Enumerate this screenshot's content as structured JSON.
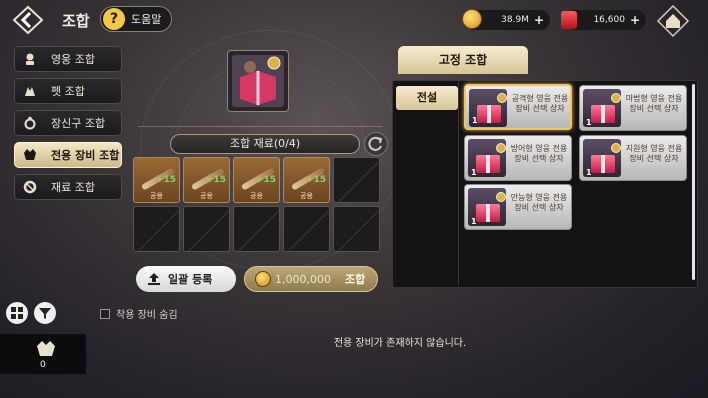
{
  "header": {
    "title": "조합",
    "help_label": "도움말",
    "help_glyph": "?"
  },
  "currency": {
    "gold": "38.9M",
    "gem": "16,600"
  },
  "menu": {
    "items": [
      {
        "label": "영웅 조합"
      },
      {
        "label": "펫 조합"
      },
      {
        "label": "장신구 조합"
      },
      {
        "label": "전용 장비 조합"
      },
      {
        "label": "재료 조합"
      }
    ],
    "active_index": 3
  },
  "materials": {
    "header": "조합 재료(0/4)",
    "cells": [
      {
        "plus": "+15",
        "tag": "공용"
      },
      {
        "plus": "+15",
        "tag": "공용"
      },
      {
        "plus": "+15",
        "tag": "공용"
      },
      {
        "plus": "+15",
        "tag": "공용"
      }
    ]
  },
  "actions": {
    "bulk_register": "일괄 등록",
    "cost": "1,000,000",
    "combine": "조합"
  },
  "fixed_combination": {
    "tab_label": "고정 조합",
    "side_tab": "전설",
    "boxes": [
      {
        "name": "공격형 영웅 전용 장비 선택 상자",
        "count": "1",
        "selected": true
      },
      {
        "name": "마법형 영웅 전용 장비 선택 상자",
        "count": "1",
        "selected": false
      },
      {
        "name": "방어형 영웅 전용 장비 선택 상자",
        "count": "1",
        "selected": false
      },
      {
        "name": "지원형 영웅 전용 장비 선택 상자",
        "count": "1",
        "selected": false
      },
      {
        "name": "만능형 영웅 전용 장비 선택 상자",
        "count": "1",
        "selected": false
      }
    ]
  },
  "inventory": {
    "hide_equipped_label": "착용 장비 숨김",
    "slot_count": "0",
    "empty_message": "전용 장비가 존재하지 않습니다."
  },
  "colors": {
    "accent": "#d8c597",
    "selected_border": "#f0c65a",
    "gold": "#f3c84a",
    "gem": "#c21d45"
  }
}
